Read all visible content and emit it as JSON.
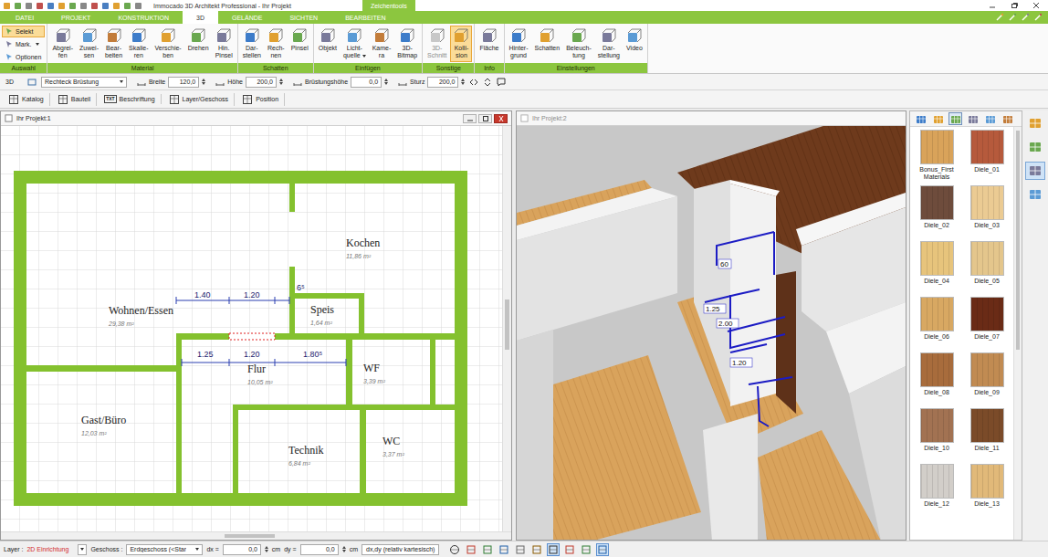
{
  "window": {
    "title": "Immocado 3D Architekt Professional - Ihr Projekt",
    "context_tab": "Zeichentools"
  },
  "ribbon_tabs": [
    {
      "label": "DATEI",
      "selected": false
    },
    {
      "label": "PROJEKT",
      "selected": false
    },
    {
      "label": "KONSTRUKTION",
      "selected": false
    },
    {
      "label": "3D",
      "selected": true
    },
    {
      "label": "GELÄNDE",
      "selected": false
    },
    {
      "label": "SICHTEN",
      "selected": false
    },
    {
      "label": "BEARBEITEN",
      "selected": false
    }
  ],
  "ribbon_groups": [
    {
      "label": "Auswahl",
      "kind": "small",
      "items": [
        {
          "label": "Selekt",
          "selected": true,
          "disabled": false,
          "dropdown": false
        },
        {
          "label": "Mark.",
          "selected": false,
          "disabled": false,
          "dropdown": true
        },
        {
          "label": "Optionen",
          "selected": false,
          "disabled": false,
          "dropdown": false
        }
      ]
    },
    {
      "label": "Material",
      "kind": "large",
      "items": [
        {
          "label": "Abgrei-\nfen",
          "selected": false,
          "disabled": false,
          "dropdown": false
        },
        {
          "label": "Zuwei-\nsen",
          "selected": false,
          "disabled": false,
          "dropdown": false
        },
        {
          "label": "Bear-\nbeiten",
          "selected": false,
          "disabled": false,
          "dropdown": false
        },
        {
          "label": "Skalie-\nren",
          "selected": false,
          "disabled": false,
          "dropdown": false
        },
        {
          "label": "Verschie-\nben",
          "selected": false,
          "disabled": false,
          "dropdown": false
        },
        {
          "label": "Drehen",
          "selected": false,
          "disabled": false,
          "dropdown": false
        },
        {
          "label": "Hin.\nPinsel",
          "selected": false,
          "disabled": false,
          "dropdown": false
        }
      ]
    },
    {
      "label": "Schatten",
      "kind": "large",
      "items": [
        {
          "label": "Dar-\nstellen",
          "selected": false,
          "disabled": false,
          "dropdown": false
        },
        {
          "label": "Rech-\nnen",
          "selected": false,
          "disabled": false,
          "dropdown": false
        },
        {
          "label": "Pinsel",
          "selected": false,
          "disabled": false,
          "dropdown": false
        }
      ]
    },
    {
      "label": "Einfügen",
      "kind": "large",
      "items": [
        {
          "label": "Objekt",
          "selected": false,
          "disabled": false,
          "dropdown": false
        },
        {
          "label": "Licht-\nquelle",
          "selected": false,
          "disabled": false,
          "dropdown": true
        },
        {
          "label": "Kame-\nra",
          "selected": false,
          "disabled": false,
          "dropdown": false
        },
        {
          "label": "3D-\nBitmap",
          "selected": false,
          "disabled": false,
          "dropdown": false
        }
      ]
    },
    {
      "label": "Sonstige",
      "kind": "large",
      "items": [
        {
          "label": "3D-\nSchnitt",
          "selected": false,
          "disabled": true,
          "dropdown": false
        },
        {
          "label": "Kolli-\nsion",
          "selected": true,
          "disabled": false,
          "dropdown": false
        }
      ]
    },
    {
      "label": "Info",
      "kind": "large",
      "items": [
        {
          "label": "Fläche",
          "selected": false,
          "disabled": false,
          "dropdown": false
        }
      ]
    },
    {
      "label": "Einstellungen",
      "kind": "large",
      "items": [
        {
          "label": "Hinter-\ngrund",
          "selected": false,
          "disabled": false,
          "dropdown": false
        },
        {
          "label": "Schatten",
          "selected": false,
          "disabled": false,
          "dropdown": false
        },
        {
          "label": "Beleuch-\ntung",
          "selected": false,
          "disabled": false,
          "dropdown": false
        },
        {
          "label": "Dar-\nstellung",
          "selected": false,
          "disabled": false,
          "dropdown": false
        },
        {
          "label": "Video",
          "selected": false,
          "disabled": false,
          "dropdown": false
        }
      ]
    }
  ],
  "properties": {
    "mode": "3D",
    "shape": "Rechteck Brüstung",
    "fields": [
      {
        "label": "Breite",
        "value": "120,0"
      },
      {
        "label": "Höhe",
        "value": "200,0"
      },
      {
        "label": "Brüstungshöhe",
        "value": "0,0"
      },
      {
        "label": "Sturz",
        "value": "200,0"
      }
    ]
  },
  "toolbar": [
    {
      "label": "Katalog",
      "badge": ""
    },
    {
      "label": "Bauteil",
      "badge": ""
    },
    {
      "label": "Beschriftung",
      "badge": "TXT"
    },
    {
      "label": "Layer/Geschoss",
      "badge": ""
    },
    {
      "label": "Position",
      "badge": ""
    }
  ],
  "plan_window": {
    "title": "Ihr Projekt:1",
    "active": true,
    "rooms": [
      {
        "name": "Kochen",
        "area": "11,86 m²"
      },
      {
        "name": "Wohnen/Essen",
        "area": "29,38 m²"
      },
      {
        "name": "Speis",
        "area": "1,64 m²"
      },
      {
        "name": "Flur",
        "area": "10,05 m²"
      },
      {
        "name": "WF",
        "area": "3,39 m²"
      },
      {
        "name": "Gast/Büro",
        "area": "12,03 m²"
      },
      {
        "name": "Technik",
        "area": "6,84 m²"
      },
      {
        "name": "WC",
        "area": "3,37 m²"
      }
    ],
    "dimensions": [
      "1.40",
      "1.20",
      "6⁵",
      "1.25",
      "1.20",
      "1.80⁵"
    ]
  },
  "view3d_window": {
    "title": "Ihr Projekt:2",
    "active": false,
    "dimensions": [
      "60",
      "1.25",
      "2.00",
      "1.20"
    ]
  },
  "catalog": {
    "tabs": [
      {
        "selected": false
      },
      {
        "selected": false
      },
      {
        "selected": true
      },
      {
        "selected": false
      },
      {
        "selected": false
      },
      {
        "selected": false
      }
    ],
    "items": [
      {
        "name": "Bonus_First Materials",
        "color": "#d9a35a"
      },
      {
        "name": "Diele_01",
        "color": "#b65a3c"
      },
      {
        "name": "Diele_02",
        "color": "#6e4c3c"
      },
      {
        "name": "Diele_03",
        "color": "#ebcb93"
      },
      {
        "name": "Diele_04",
        "color": "#e7c47c"
      },
      {
        "name": "Diele_05",
        "color": "#e4c68c"
      },
      {
        "name": "Diele_06",
        "color": "#d8a862"
      },
      {
        "name": "Diele_07",
        "color": "#6a2b16"
      },
      {
        "name": "Diele_08",
        "color": "#a86c3c"
      },
      {
        "name": "Diele_09",
        "color": "#c18b52"
      },
      {
        "name": "Diele_10",
        "color": "#a27252"
      },
      {
        "name": "Diele_11",
        "color": "#7b4b29"
      },
      {
        "name": "Diele_12",
        "color": "#d2cec9"
      },
      {
        "name": "Diele_13",
        "color": "#e1b979"
      }
    ]
  },
  "side_strip": [
    {
      "selected": false
    },
    {
      "selected": false
    },
    {
      "selected": true
    },
    {
      "selected": false
    }
  ],
  "status_bar": {
    "layer_label": "Layer :",
    "layer": "2D Einrichtung",
    "floor_label": "Geschoss :",
    "floor": "Erdgeschoss (<Star",
    "dx_label": "dx =",
    "dx": "0,0",
    "dx_unit": "cm",
    "dy_label": "dy =",
    "dy": "0,0",
    "dy_unit": "cm",
    "mode": "dx,dy (relativ kartesisch)",
    "tools": [
      {
        "selected": false
      },
      {
        "selected": false
      },
      {
        "selected": false
      },
      {
        "selected": false
      },
      {
        "selected": false
      },
      {
        "selected": false
      },
      {
        "selected": true
      },
      {
        "selected": false
      },
      {
        "selected": false
      },
      {
        "selected": true
      }
    ]
  }
}
